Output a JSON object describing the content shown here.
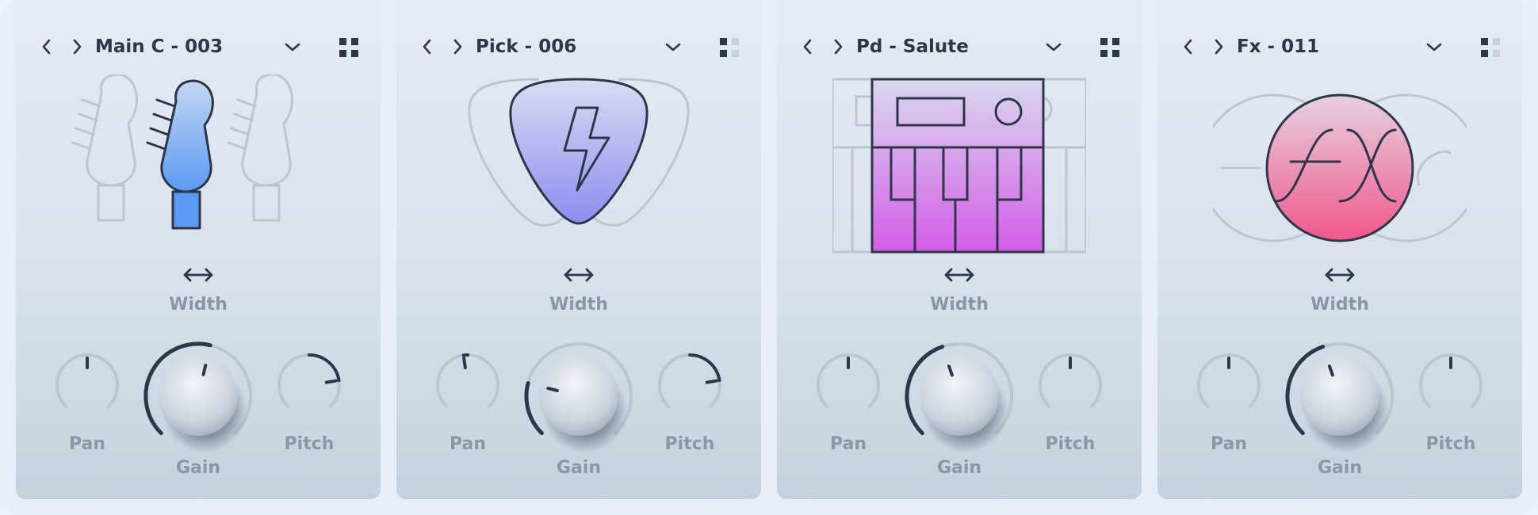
{
  "panels": [
    {
      "name": "Main C - 003",
      "illustration": "guitar-headstocks",
      "width_label": "Width",
      "pan": {
        "label": "Pan",
        "value": 0.5
      },
      "gain": {
        "label": "Gain",
        "value": 0.55
      },
      "pitch": {
        "label": "Pitch",
        "value": 0.8
      }
    },
    {
      "name": "Pick - 006",
      "illustration": "guitar-pick",
      "width_label": "Width",
      "pan": {
        "label": "Pan",
        "value": 0.47
      },
      "gain": {
        "label": "Gain",
        "value": 0.22
      },
      "pitch": {
        "label": "Pitch",
        "value": 0.8
      }
    },
    {
      "name": "Pd - Salute",
      "illustration": "synth-keys",
      "width_label": "Width",
      "pan": {
        "label": "Pan",
        "value": 0.5
      },
      "gain": {
        "label": "Gain",
        "value": 0.43
      },
      "pitch": {
        "label": "Pitch",
        "value": 0.5
      }
    },
    {
      "name": "Fx - 011",
      "illustration": "fx-circle",
      "width_label": "Width",
      "pan": {
        "label": "Pan",
        "value": 0.5
      },
      "gain": {
        "label": "Gain",
        "value": 0.43
      },
      "pitch": {
        "label": "Pitch",
        "value": 0.5
      }
    }
  ],
  "colors": {
    "text_dark": "#2d3748",
    "text_muted": "#8a97a8",
    "guitar_gradient": [
      "#c4d6f3",
      "#5a9af2"
    ],
    "pick_gradient": [
      "#d9dcf2",
      "#8f8cf0"
    ],
    "keys_gradient": [
      "#d9d9ee",
      "#d45de8"
    ],
    "fx_gradient": [
      "#e6d0e0",
      "#f0588c"
    ]
  }
}
